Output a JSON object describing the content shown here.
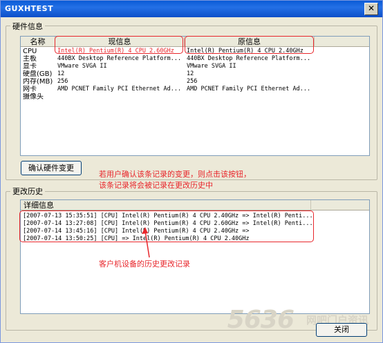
{
  "window": {
    "title": "GUXHTEST",
    "close_glyph": "✕"
  },
  "hardware_group": {
    "label": "硬件信息",
    "columns": [
      "名称",
      "现信息",
      "原信息"
    ],
    "rows": [
      {
        "name": "CPU",
        "current": "Intel(R) Pentium(R) 4 CPU 2.60GHz",
        "original": "Intel(R) Pentium(R) 4 CPU 2.40GHz"
      },
      {
        "name": "主板",
        "current": "440BX Desktop Reference Platform...",
        "original": "440BX Desktop Reference Platform..."
      },
      {
        "name": "显卡",
        "current": "VMware SVGA II",
        "original": "VMware SVGA II"
      },
      {
        "name": "硬盘(GB)",
        "current": "12",
        "original": "12"
      },
      {
        "name": "内存(MB)",
        "current": "256",
        "original": "256"
      },
      {
        "name": "网卡",
        "current": "AMD PCNET Family PCI Ethernet Ad...",
        "original": "AMD PCNET Family PCI Ethernet Ad..."
      },
      {
        "name": "摄像头",
        "current": "",
        "original": ""
      }
    ],
    "confirm_button": "确认硬件变更"
  },
  "annotations": {
    "confirm_note_line1": "若用户确认该条记录的变更，则点击该按钮，",
    "confirm_note_line2": "该条记录将会被记录在更改历史中",
    "history_note": "客户机设备的历史更改记录"
  },
  "history_group": {
    "label": "更改历史",
    "column": "详细信息",
    "rows": [
      "[2007-07-13 15:35:51] [CPU] Intel(R) Pentium(R) 4 CPU 2.40GHz => Intel(R) Penti...",
      "[2007-07-14 13:27:08] [CPU] Intel(R) Pentium(R) 4 CPU 2.60GHz => Intel(R) Penti...",
      "[2007-07-14 13:45:16] [CPU] Intel(R) Pentium(R) 4 CPU 2.40GHz =>",
      "[2007-07-14 13:50:25] [CPU]  => Intel(R) Pentium(R) 4 CPU 2.40GHz"
    ]
  },
  "close_button": "关闭",
  "watermark": {
    "number": "5636",
    "text": "网吧门户资讯"
  },
  "colors": {
    "annotation": "#e8262b",
    "titlebar": "#0a5bd6"
  }
}
